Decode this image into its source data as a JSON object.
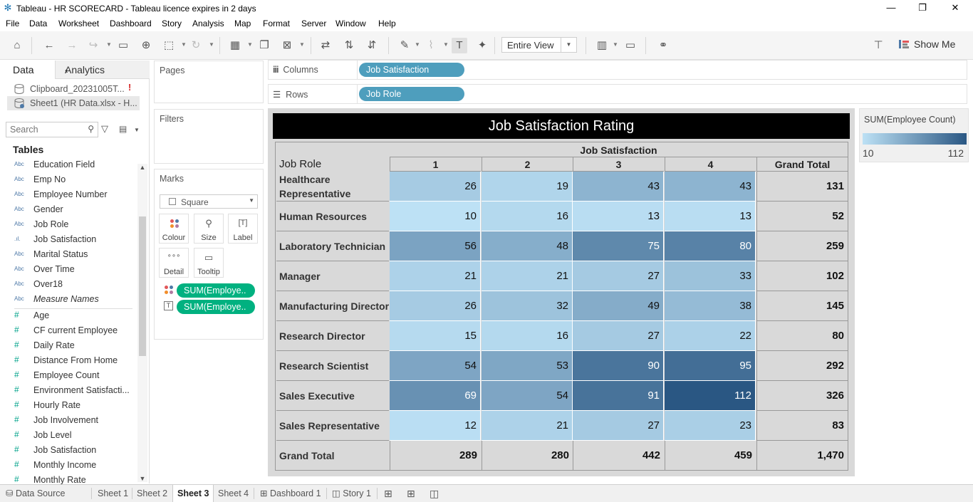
{
  "window": {
    "title": "Tableau - HR SCORECARD - Tableau licence expires in 2 days",
    "minimize": "—",
    "restore": "❐",
    "close": "✕"
  },
  "menu": [
    "File",
    "Data",
    "Worksheet",
    "Dashboard",
    "Story",
    "Analysis",
    "Map",
    "Format",
    "Server",
    "Window",
    "Help"
  ],
  "toolbar": {
    "fit_value": "Entire View",
    "show_me": "Show Me"
  },
  "data_pane": {
    "tab_data": "Data",
    "tab_analytics": "Analytics",
    "datasources": [
      "Clipboard_20231005T...",
      "Sheet1 (HR Data.xlsx - H..."
    ],
    "warning": "!",
    "search_placeholder": "Search",
    "tables_heading": "Tables",
    "dimensions": [
      {
        "type": "Abc",
        "name": "Education Field"
      },
      {
        "type": "Abc",
        "name": "Emp No"
      },
      {
        "type": "Abc",
        "name": "Employee Number"
      },
      {
        "type": "Abc",
        "name": "Gender"
      },
      {
        "type": "Abc",
        "name": "Job Role"
      },
      {
        "type": ".ıl.",
        "name": "Job Satisfaction"
      },
      {
        "type": "Abc",
        "name": "Marital Status"
      },
      {
        "type": "Abc",
        "name": "Over Time"
      },
      {
        "type": "Abc",
        "name": "Over18"
      },
      {
        "type": "Abc",
        "name": "Measure Names"
      }
    ],
    "measures": [
      {
        "type": "#",
        "name": "Age"
      },
      {
        "type": "#",
        "name": "CF current Employee"
      },
      {
        "type": "#",
        "name": "Daily Rate"
      },
      {
        "type": "#",
        "name": "Distance From Home"
      },
      {
        "type": "#",
        "name": "Employee Count"
      },
      {
        "type": "#",
        "name": "Environment Satisfacti..."
      },
      {
        "type": "#",
        "name": "Hourly Rate"
      },
      {
        "type": "#",
        "name": "Job Involvement"
      },
      {
        "type": "#",
        "name": "Job Level"
      },
      {
        "type": "#",
        "name": "Job Satisfaction"
      },
      {
        "type": "#",
        "name": "Monthly Income"
      },
      {
        "type": "#",
        "name": "Monthly Rate"
      }
    ]
  },
  "cards": {
    "pages": "Pages",
    "filters": "Filters",
    "marks": "Marks",
    "mark_type": "Square",
    "buttons": [
      "Colour",
      "Size",
      "Label",
      "Detail",
      "Tooltip"
    ],
    "pills": [
      "SUM(Employe..",
      "SUM(Employe.."
    ]
  },
  "shelves": {
    "columns_label": "Columns",
    "columns_pill": "Job Satisfaction",
    "rows_label": "Rows",
    "rows_pill": "Job Role"
  },
  "viz": {
    "title": "Job Satisfaction Rating",
    "row_header": "Job Role",
    "col_header": "Job Satisfaction",
    "columns": [
      "1",
      "2",
      "3",
      "4",
      "Grand Total"
    ],
    "rows": [
      {
        "role": "Healthcare Representative",
        "values": [
          26,
          19,
          43,
          43
        ],
        "total": "131"
      },
      {
        "role": "Human Resources",
        "values": [
          10,
          16,
          13,
          13
        ],
        "total": "52"
      },
      {
        "role": "Laboratory Technician",
        "values": [
          56,
          48,
          75,
          80
        ],
        "total": "259"
      },
      {
        "role": "Manager",
        "values": [
          21,
          21,
          27,
          33
        ],
        "total": "102"
      },
      {
        "role": "Manufacturing Director",
        "values": [
          26,
          32,
          49,
          38
        ],
        "total": "145"
      },
      {
        "role": "Research Director",
        "values": [
          15,
          16,
          27,
          22
        ],
        "total": "80"
      },
      {
        "role": "Research Scientist",
        "values": [
          54,
          53,
          90,
          95
        ],
        "total": "292"
      },
      {
        "role": "Sales Executive",
        "values": [
          69,
          54,
          91,
          112
        ],
        "total": "326"
      },
      {
        "role": "Sales Representative",
        "values": [
          12,
          21,
          27,
          23
        ],
        "total": "83"
      }
    ],
    "grand_total_label": "Grand Total",
    "grand_totals": [
      "289",
      "280",
      "442",
      "459",
      "1,470"
    ]
  },
  "legend": {
    "title": "SUM(Employee Count)",
    "min": "10",
    "max": "112",
    "min_color": "#bde1f5",
    "max_color": "#2a5783"
  },
  "bottom_tabs": {
    "data_source": "Data Source",
    "sheets": [
      "Sheet 1",
      "Sheet 2",
      "Sheet 3",
      "Sheet 4"
    ],
    "active": "Sheet 3",
    "dashboard": "Dashboard 1",
    "story": "Story 1"
  }
}
